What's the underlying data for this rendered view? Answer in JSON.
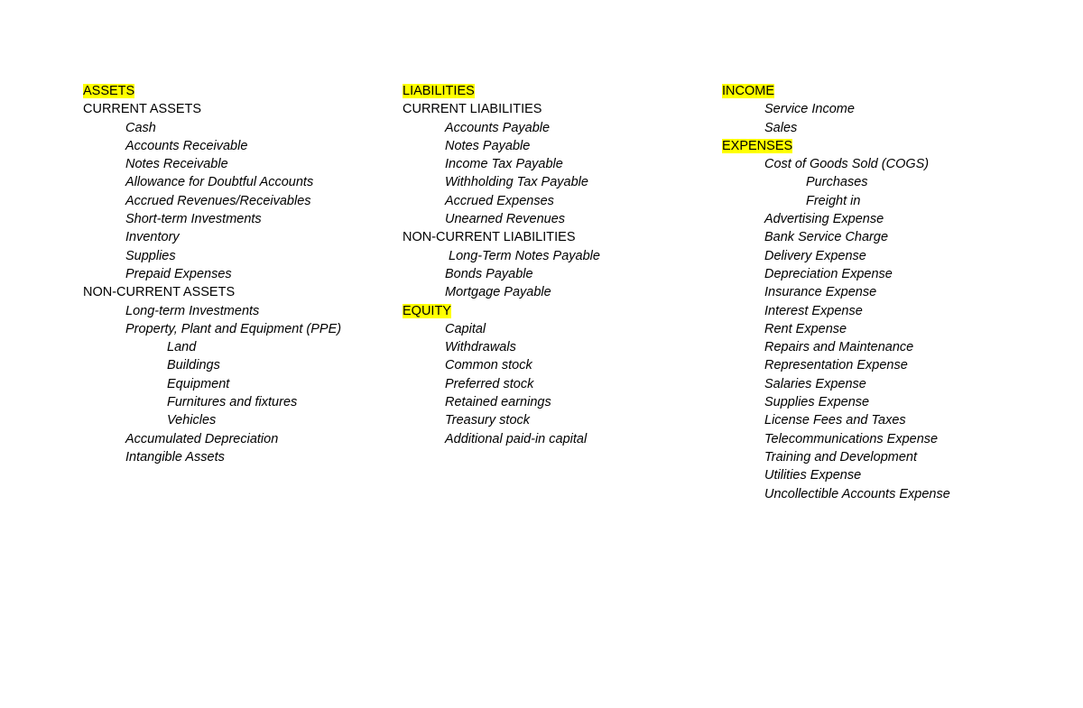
{
  "colors": {
    "highlight": "#ffff00",
    "text": "#000000"
  },
  "columns": [
    {
      "lines": [
        {
          "kind": "heading",
          "text": "ASSETS"
        },
        {
          "kind": "subheading",
          "text": "CURRENT ASSETS"
        },
        {
          "kind": "item",
          "text": "Cash"
        },
        {
          "kind": "item",
          "text": "Accounts Receivable"
        },
        {
          "kind": "item",
          "text": "Notes Receivable"
        },
        {
          "kind": "item",
          "text": "Allowance for Doubtful Accounts"
        },
        {
          "kind": "item",
          "text": "Accrued Revenues/Receivables"
        },
        {
          "kind": "item",
          "text": "Short-term Investments"
        },
        {
          "kind": "item",
          "text": "Inventory"
        },
        {
          "kind": "item",
          "text": "Supplies"
        },
        {
          "kind": "item",
          "text": "Prepaid Expenses"
        },
        {
          "kind": "subheading",
          "text": "NON-CURRENT ASSETS"
        },
        {
          "kind": "item",
          "text": "Long-term Investments"
        },
        {
          "kind": "item",
          "text": "Property, Plant and Equipment (PPE)"
        },
        {
          "kind": "subitem",
          "text": "Land"
        },
        {
          "kind": "subitem",
          "text": "Buildings"
        },
        {
          "kind": "subitem",
          "text": "Equipment"
        },
        {
          "kind": "subitem",
          "text": "Furnitures and fixtures"
        },
        {
          "kind": "subitem",
          "text": "Vehicles"
        },
        {
          "kind": "item",
          "text": "Accumulated Depreciation"
        },
        {
          "kind": "item",
          "text": "Intangible Assets"
        }
      ]
    },
    {
      "lines": [
        {
          "kind": "heading",
          "text": "LIABILITIES"
        },
        {
          "kind": "subheading",
          "text": "CURRENT LIABILITIES"
        },
        {
          "kind": "item",
          "text": "Accounts Payable"
        },
        {
          "kind": "item",
          "text": "Notes Payable"
        },
        {
          "kind": "item",
          "text": "Income Tax Payable"
        },
        {
          "kind": "item",
          "text": "Withholding Tax Payable"
        },
        {
          "kind": "item",
          "text": "Accrued Expenses"
        },
        {
          "kind": "item",
          "text": "Unearned Revenues"
        },
        {
          "kind": "subheading",
          "text": "NON-CURRENT LIABILITIES"
        },
        {
          "kind": "item",
          "text": " Long-Term Notes Payable"
        },
        {
          "kind": "item",
          "text": "Bonds Payable"
        },
        {
          "kind": "item",
          "text": "Mortgage Payable"
        },
        {
          "kind": "heading",
          "text": "EQUITY"
        },
        {
          "kind": "item",
          "text": "Capital"
        },
        {
          "kind": "item",
          "text": "Withdrawals"
        },
        {
          "kind": "item",
          "text": "Common stock"
        },
        {
          "kind": "item",
          "text": "Preferred stock"
        },
        {
          "kind": "item",
          "text": "Retained earnings"
        },
        {
          "kind": "item",
          "text": "Treasury stock"
        },
        {
          "kind": "item",
          "text": "Additional paid-in capital"
        }
      ]
    },
    {
      "lines": [
        {
          "kind": "heading",
          "text": "INCOME"
        },
        {
          "kind": "item",
          "text": "Service Income"
        },
        {
          "kind": "item",
          "text": "Sales"
        },
        {
          "kind": "heading",
          "text": "EXPENSES"
        },
        {
          "kind": "item",
          "text": "Cost of Goods Sold (COGS)"
        },
        {
          "kind": "subitem",
          "text": "Purchases"
        },
        {
          "kind": "subitem",
          "text": "Freight in"
        },
        {
          "kind": "item",
          "text": "Advertising Expense"
        },
        {
          "kind": "item",
          "text": "Bank Service Charge"
        },
        {
          "kind": "item",
          "text": "Delivery Expense"
        },
        {
          "kind": "item",
          "text": "Depreciation Expense"
        },
        {
          "kind": "item",
          "text": "Insurance Expense"
        },
        {
          "kind": "item",
          "text": "Interest Expense"
        },
        {
          "kind": "item",
          "text": "Rent Expense"
        },
        {
          "kind": "item",
          "text": "Repairs and Maintenance"
        },
        {
          "kind": "item",
          "text": "Representation Expense"
        },
        {
          "kind": "item",
          "text": "Salaries Expense"
        },
        {
          "kind": "item",
          "text": "Supplies Expense"
        },
        {
          "kind": "item",
          "text": "License Fees and Taxes"
        },
        {
          "kind": "item",
          "text": "Telecommunications Expense"
        },
        {
          "kind": "item",
          "text": "Training and Development"
        },
        {
          "kind": "item",
          "text": "Utilities Expense"
        },
        {
          "kind": "item",
          "text": "Uncollectible Accounts Expense"
        }
      ]
    }
  ]
}
